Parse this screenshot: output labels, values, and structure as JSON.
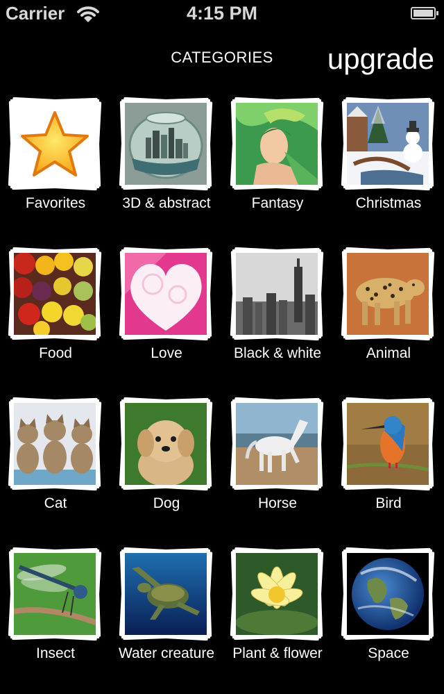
{
  "status_bar": {
    "carrier": "Carrier",
    "time": "4:15 PM"
  },
  "nav": {
    "title": "CATEGORIES",
    "upgrade_label": "upgrade"
  },
  "categories": [
    {
      "label": "Favorites",
      "icon": "star-icon"
    },
    {
      "label": "3D & abstract",
      "icon": "fishbowl-city-image"
    },
    {
      "label": "Fantasy",
      "icon": "fantasy-woman-image"
    },
    {
      "label": "Christmas",
      "icon": "snowman-image"
    },
    {
      "label": "Food",
      "icon": "fruit-image"
    },
    {
      "label": "Love",
      "icon": "heart-image"
    },
    {
      "label": "Black & white",
      "icon": "city-skyline-image"
    },
    {
      "label": "Animal",
      "icon": "leopard-image"
    },
    {
      "label": "Cat",
      "icon": "kittens-image"
    },
    {
      "label": "Dog",
      "icon": "puppy-image"
    },
    {
      "label": "Horse",
      "icon": "horse-image"
    },
    {
      "label": "Bird",
      "icon": "kingfisher-image"
    },
    {
      "label": "Insect",
      "icon": "dragonfly-image"
    },
    {
      "label": "Water creature",
      "icon": "sea-turtle-image"
    },
    {
      "label": "Plant & flower",
      "icon": "water-lily-image"
    },
    {
      "label": "Space",
      "icon": "earth-image"
    }
  ]
}
